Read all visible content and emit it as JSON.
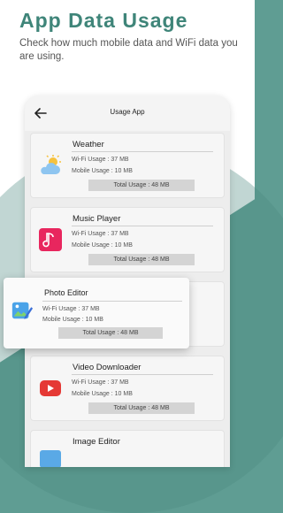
{
  "headline": "App Data Usage",
  "subtext": "Check how much mobile data and WiFi data you are using.",
  "phone": {
    "title": "Usage App"
  },
  "apps": [
    {
      "name": "Weather",
      "wifi": "Wi-Fi Usage : 37 MB",
      "mobile": "Mobile Usage : 10 MB",
      "total": "Total Usage : 48 MB",
      "icon": "weather-icon"
    },
    {
      "name": "Music Player",
      "wifi": "Wi-Fi Usage : 37 MB",
      "mobile": "Mobile Usage : 10 MB",
      "total": "Total Usage : 48 MB",
      "icon": "music-icon"
    },
    {
      "name": "Photo Editor",
      "wifi": "Wi-Fi Usage : 37 MB",
      "mobile": "Mobile Usage : 10 MB",
      "total": "Total Usage : 48 MB",
      "icon": "photo-editor-icon"
    },
    {
      "name": "Video Downloader",
      "wifi": "Wi-Fi Usage : 37 MB",
      "mobile": "Mobile Usage : 10 MB",
      "total": "Total Usage : 48 MB",
      "icon": "video-icon"
    },
    {
      "name": "Image Editor",
      "icon": "image-editor-icon"
    }
  ],
  "colors": {
    "accent": "#3f8579",
    "background": "#5f9d93",
    "music": "#e8265e",
    "video": "#e53935"
  }
}
